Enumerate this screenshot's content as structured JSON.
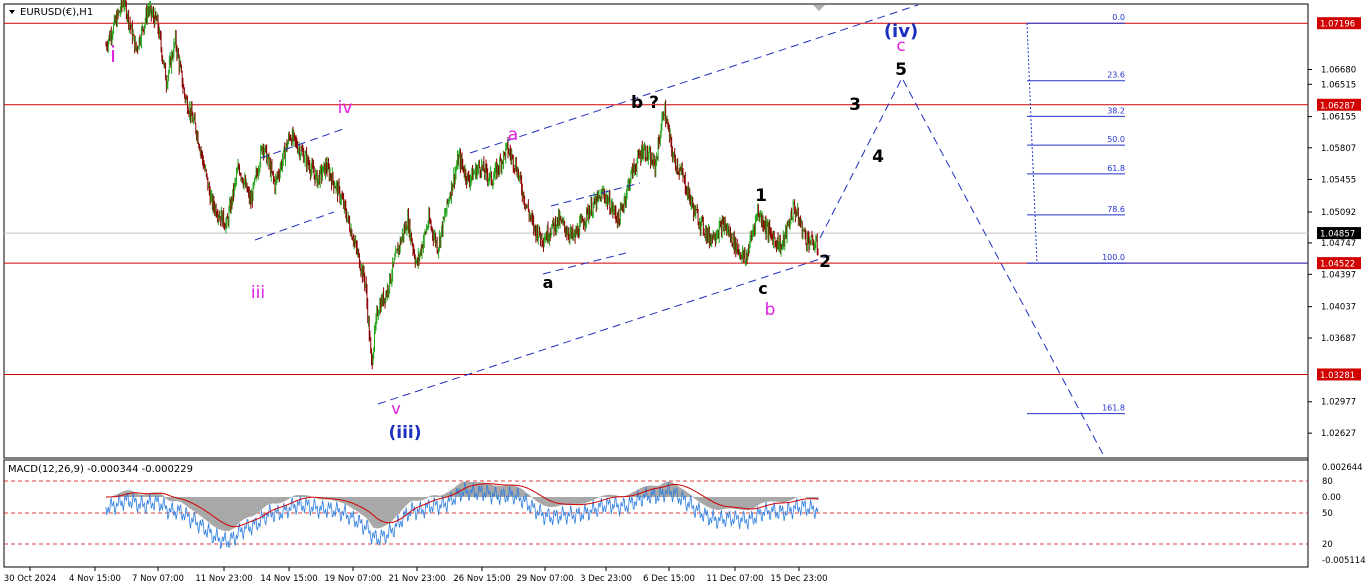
{
  "chart_data": {
    "type": "candlestick",
    "symbol": "EURUSD(€),H1",
    "colors": {
      "up": "#26a51f",
      "down": "#8b0000",
      "resistance": "#d00000",
      "price_label_bg": "#d00000",
      "current_label_bg": "#000000",
      "channel": "#1d2fbf",
      "fib": "#2233cc",
      "wave_magenta": "#e020e0",
      "wave_blue": "#1d2fbf",
      "wave_black": "#000000",
      "macd_hist": "#a8a8a8",
      "macd_signal": "#d00000",
      "macd_line": "#2f7fe0"
    },
    "y_axis": {
      "ylim": [
        1.0235,
        1.0741
      ],
      "tick_labels": [
        "1.06680",
        "1.06515",
        "1.06155",
        "1.05807",
        "1.05455",
        "1.05092",
        "1.04747",
        "1.04397",
        "1.04037",
        "1.03687",
        "1.02977",
        "1.02627"
      ]
    },
    "x_axis": {
      "tick_labels": [
        "30 Oct 2024",
        "4 Nov 15:00",
        "7 Nov 07:00",
        "11 Nov 23:00",
        "14 Nov 15:00",
        "19 Nov 07:00",
        "21 Nov 23:00",
        "26 Nov 15:00",
        "29 Nov 07:00",
        "3 Dec 23:00",
        "6 Dec 15:00",
        "11 Dec 07:00",
        "15 Dec 23:00"
      ]
    },
    "horizontal_levels": [
      {
        "price": 1.07196,
        "label": "1.07196"
      },
      {
        "price": 1.06287,
        "label": "1.06287"
      },
      {
        "price": 1.04522,
        "label": "1.04522"
      },
      {
        "price": 1.03281,
        "label": "1.03281"
      }
    ],
    "current_price": {
      "price": 1.04857,
      "label": "1.04857"
    },
    "price_path": [
      [
        0,
        1.0695
      ],
      [
        6,
        1.0745
      ],
      [
        10,
        1.069
      ],
      [
        14,
        1.0735
      ],
      [
        17,
        1.072
      ],
      [
        20,
        1.0655
      ],
      [
        23,
        1.07
      ],
      [
        26,
        1.064
      ],
      [
        30,
        1.06
      ],
      [
        35,
        1.052
      ],
      [
        40,
        1.0495
      ],
      [
        44,
        1.056
      ],
      [
        48,
        1.052
      ],
      [
        52,
        1.0585
      ],
      [
        56,
        1.054
      ],
      [
        61,
        1.0595
      ],
      [
        66,
        1.057
      ],
      [
        70,
        1.0545
      ],
      [
        73,
        1.056
      ],
      [
        78,
        1.0525
      ],
      [
        82,
        1.048
      ],
      [
        86,
        1.043
      ],
      [
        88,
        1.034
      ],
      [
        90,
        1.04
      ],
      [
        93,
        1.042
      ],
      [
        97,
        1.047
      ],
      [
        100,
        1.05
      ],
      [
        103,
        1.045
      ],
      [
        107,
        1.05
      ],
      [
        110,
        1.047
      ],
      [
        114,
        1.053
      ],
      [
        117,
        1.057
      ],
      [
        120,
        1.0545
      ],
      [
        124,
        1.056
      ],
      [
        128,
        1.0545
      ],
      [
        133,
        1.058
      ],
      [
        136,
        1.056
      ],
      [
        139,
        1.052
      ],
      [
        142,
        1.049
      ],
      [
        145,
        1.048
      ],
      [
        150,
        1.05
      ],
      [
        155,
        1.048
      ],
      [
        160,
        1.051
      ],
      [
        165,
        1.053
      ],
      [
        170,
        1.05
      ],
      [
        174,
        1.055
      ],
      [
        178,
        1.058
      ],
      [
        182,
        1.056
      ],
      [
        185,
        1.0625
      ],
      [
        188,
        1.057
      ],
      [
        191,
        1.055
      ],
      [
        195,
        1.051
      ],
      [
        200,
        1.048
      ],
      [
        205,
        1.0495
      ],
      [
        209,
        1.047
      ],
      [
        212,
        1.0455
      ],
      [
        216,
        1.051
      ],
      [
        220,
        1.0485
      ],
      [
        224,
        1.047
      ],
      [
        228,
        1.0515
      ],
      [
        232,
        1.048
      ],
      [
        236,
        1.047
      ]
    ],
    "wave_labels": [
      {
        "text": "i",
        "color": "magenta"
      },
      {
        "text": "iii",
        "color": "magenta"
      },
      {
        "text": "iv",
        "color": "magenta"
      },
      {
        "text": "v",
        "color": "magenta"
      },
      {
        "text": "(iii)",
        "color": "blue"
      },
      {
        "text": "a",
        "color": "magenta"
      },
      {
        "text": "a",
        "color": "black"
      },
      {
        "text": "b ?",
        "color": "black"
      },
      {
        "text": "c",
        "color": "black"
      },
      {
        "text": "b",
        "color": "magenta"
      },
      {
        "text": "1",
        "color": "black"
      },
      {
        "text": "2",
        "color": "black"
      },
      {
        "text": "3",
        "color": "black"
      },
      {
        "text": "4",
        "color": "black"
      },
      {
        "text": "5",
        "color": "black"
      },
      {
        "text": "(iv)",
        "color": "blue"
      },
      {
        "text": "c",
        "color": "magenta"
      }
    ],
    "fibonacci": [
      {
        "level": "0.0",
        "price": 1.07196
      },
      {
        "level": "23.6",
        "price": 1.06555
      },
      {
        "level": "38.2",
        "price": 1.06158
      },
      {
        "level": "50.0",
        "price": 1.05837
      },
      {
        "level": "61.8",
        "price": 1.05517
      },
      {
        "level": "78.6",
        "price": 1.0506
      },
      {
        "level": "100.0",
        "price": 1.04522
      },
      {
        "level": "161.8",
        "price": 1.02844
      }
    ],
    "macd": {
      "label": "MACD(12,26,9) -0.000344 -0.000229",
      "tick_labels": [
        "0.002644",
        "80",
        "0.00",
        "50",
        "20",
        "-0.005114"
      ]
    }
  }
}
